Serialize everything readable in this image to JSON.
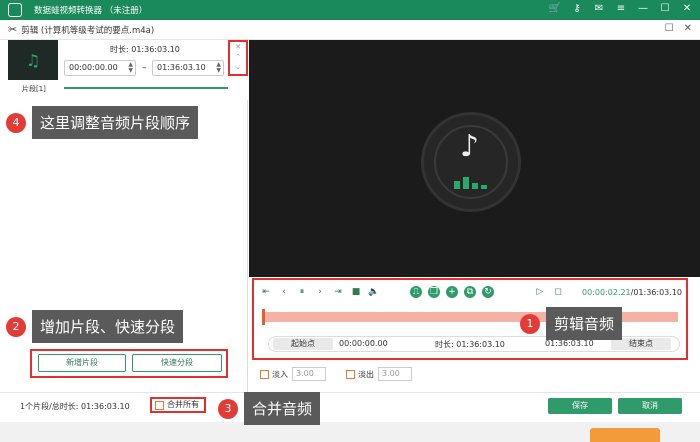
{
  "app": {
    "title": "数据蛙视频转换器 （未注册）"
  },
  "dialog": {
    "title": "剪辑 (计算机等级考试的要点.m4a)"
  },
  "clip": {
    "thumb_icon": "music-note-icon",
    "label": "片段[1]",
    "duration_label": "时长: 01:36:03.10",
    "start": "00:00:00.00",
    "end": "01:36:03.10"
  },
  "callouts": {
    "c1": {
      "num": "1",
      "text": "剪辑音频"
    },
    "c2": {
      "num": "2",
      "text": "增加片段、快速分段"
    },
    "c3": {
      "num": "3",
      "text": "合并音频"
    },
    "c4": {
      "num": "4",
      "text": "这里调整音频片段顺序"
    }
  },
  "left_buttons": {
    "add": "新增片段",
    "split": "快速分段"
  },
  "player": {
    "current": "00:00:02.21",
    "total": "/01:36:03.10",
    "trim": {
      "start_btn": "起始点",
      "start_val": "00:00:00.00",
      "dur_label": "时长: 01:36:03.10",
      "end_val": "01:36:03.10",
      "end_btn": "结束点"
    }
  },
  "fade": {
    "in_label": "淡入",
    "in_val": "3.00",
    "out_label": "淡出",
    "out_val": "3.00"
  },
  "footer": {
    "info": "1个片段/总时长: 01:36:03.10",
    "merge": "合并所有",
    "save": "保存",
    "cancel": "取消"
  },
  "colors": {
    "brand": "#1a8a5a",
    "accent": "#2f9a6a",
    "callout": "#e33b36"
  }
}
